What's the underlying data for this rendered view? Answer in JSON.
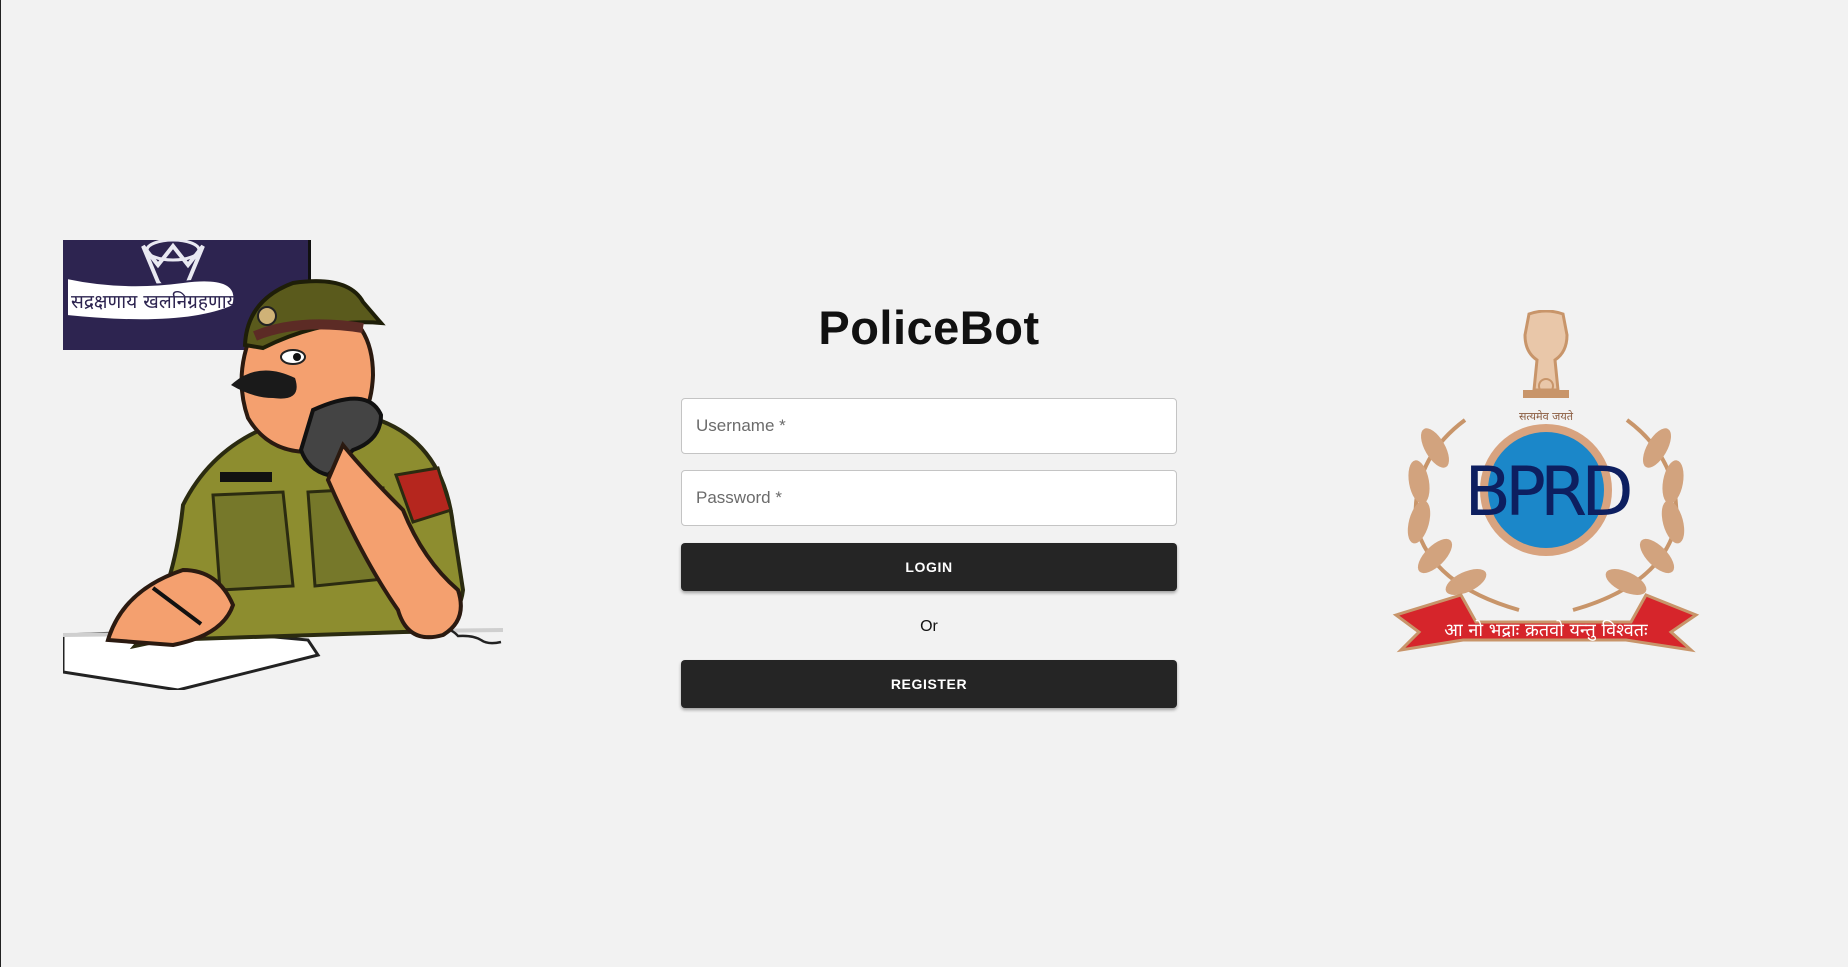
{
  "app": {
    "title": "PoliceBot"
  },
  "form": {
    "username": {
      "placeholder": "Username *",
      "value": ""
    },
    "password": {
      "placeholder": "Password *",
      "value": ""
    },
    "login_label": "LOGIN",
    "or_label": "Or",
    "register_label": "REGISTER"
  },
  "images": {
    "left": {
      "icon": "police-officer-illustration",
      "sign_text": "सद्रक्षणाय खलनिग्रहणाय"
    },
    "right": {
      "icon": "bprd-emblem",
      "top_text": "सत्यमेव जयते",
      "logo_text": "BPRD",
      "ribbon_text": "आ नो भद्राः क्रतवो यन्तु विश्वतः"
    }
  },
  "colors": {
    "background": "#f2f2f2",
    "button": "#252525",
    "button_text": "#ffffff",
    "emblem_blue": "#1b87c9",
    "emblem_gold": "#c8956a",
    "ribbon_red": "#d6252b"
  }
}
